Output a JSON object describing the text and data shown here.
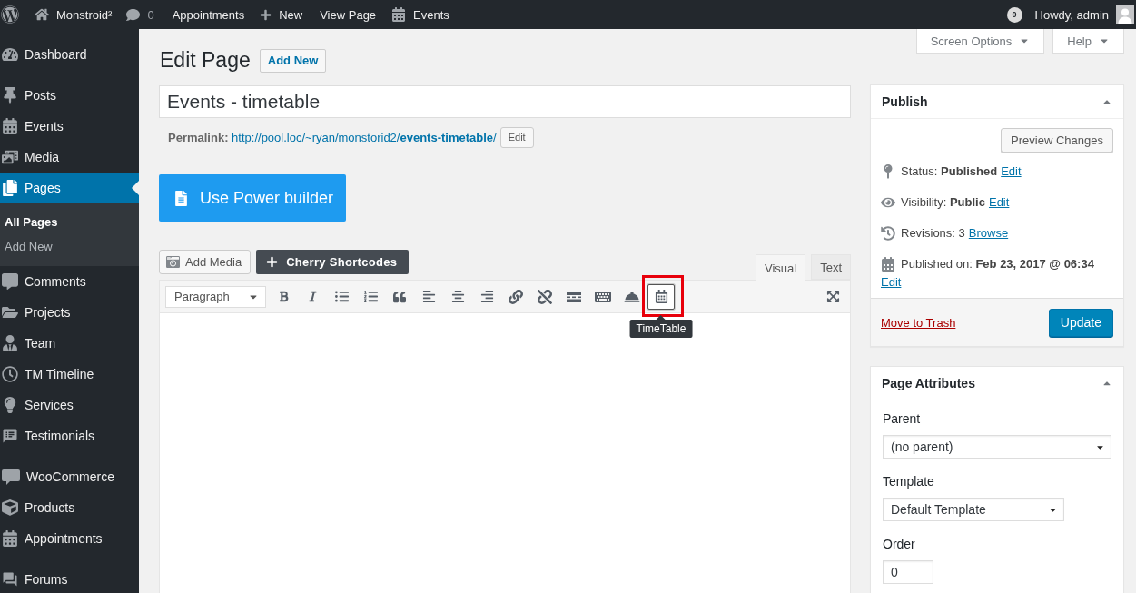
{
  "admin_bar": {
    "site_name": "Monstroid²",
    "comment_count": "0",
    "links": [
      {
        "kind": "text",
        "label": "Appointments"
      },
      {
        "kind": "new",
        "label": "New"
      },
      {
        "kind": "text",
        "label": "View Page"
      },
      {
        "kind": "calendar",
        "label": "Events"
      }
    ],
    "notification_count": "0",
    "greeting": "Howdy, admin"
  },
  "sidebar": {
    "sections": [
      {
        "items": [
          {
            "label": "Dashboard",
            "selected": false
          }
        ]
      },
      {
        "items": [
          {
            "label": "Posts",
            "selected": false
          },
          {
            "label": "Events",
            "selected": false
          },
          {
            "label": "Media",
            "selected": false
          },
          {
            "label": "Pages",
            "selected": true,
            "children": [
              {
                "label": "All Pages",
                "selected": true
              },
              {
                "label": "Add New",
                "selected": false
              }
            ]
          },
          {
            "label": "Comments",
            "selected": false
          },
          {
            "label": "Projects",
            "selected": false
          },
          {
            "label": "Team",
            "selected": false
          },
          {
            "label": "TM Timeline",
            "selected": false
          },
          {
            "label": "Services",
            "selected": false
          },
          {
            "label": "Testimonials",
            "selected": false
          }
        ]
      },
      {
        "items": [
          {
            "label": "WooCommerce",
            "selected": false
          },
          {
            "label": "Products",
            "selected": false
          },
          {
            "label": "Appointments",
            "selected": false
          }
        ]
      },
      {
        "items": [
          {
            "label": "Forums",
            "selected": false
          }
        ]
      }
    ]
  },
  "screen_tabs": [
    {
      "label": "Screen Options"
    },
    {
      "label": "Help"
    }
  ],
  "heading": {
    "title": "Edit Page",
    "button": "Add New"
  },
  "title_field": {
    "value": "Events - timetable"
  },
  "permalink": {
    "label": "Permalink:",
    "url": "http://pool.loc/~ryan/monstorid2/**events-timetable**/",
    "button": "Edit"
  },
  "power_builder_button": "Use Power builder",
  "editor": {
    "add_media_button": "Add Media",
    "shortcodes_button": "Cherry Shortcodes",
    "tabs": [
      {
        "label": "Visual",
        "selected": true
      },
      {
        "label": "Text",
        "selected": false
      }
    ],
    "format_select": "Paragraph",
    "buttons": [
      {
        "kind": "bold",
        "focused": false,
        "annotated": false
      },
      {
        "kind": "italic",
        "focused": false,
        "annotated": false
      },
      {
        "kind": "bullet_list",
        "focused": false,
        "annotated": false
      },
      {
        "kind": "numbered_list",
        "focused": false,
        "annotated": false
      },
      {
        "kind": "blockquote",
        "focused": false,
        "annotated": false
      },
      {
        "kind": "align_left",
        "focused": false,
        "annotated": false
      },
      {
        "kind": "align_center",
        "focused": false,
        "annotated": false
      },
      {
        "kind": "align_right",
        "focused": false,
        "annotated": false
      },
      {
        "kind": "link",
        "focused": false,
        "annotated": false
      },
      {
        "kind": "unlink",
        "focused": false,
        "annotated": false
      },
      {
        "kind": "read_more",
        "focused": false,
        "annotated": false
      },
      {
        "kind": "toolbar_toggle",
        "focused": false,
        "annotated": false
      },
      {
        "kind": "service_bell",
        "focused": false,
        "annotated": false
      },
      {
        "kind": "timetable",
        "focused": true,
        "annotated": true,
        "tooltip": "TimeTable"
      }
    ]
  },
  "publish_box": {
    "title": "Publish",
    "preview_button": "Preview Changes",
    "rows": [
      {
        "text": "Status: **Published**",
        "link": "Edit"
      },
      {
        "text": "Visibility: **Public**",
        "link": "Edit"
      },
      {
        "text": "Revisions: 3",
        "link": "Browse"
      },
      {
        "text": "Published on: **Feb 23, 2017 @ 06:34**",
        "link": "Edit"
      }
    ],
    "trash_link": "Move to Trash",
    "update_button": "Update"
  },
  "page_attributes": {
    "title": "Page Attributes",
    "parent": {
      "label": "Parent",
      "value": "(no parent)"
    },
    "template": {
      "label": "Template",
      "value": "Default Template"
    },
    "order": {
      "label": "Order",
      "value": "0"
    }
  }
}
